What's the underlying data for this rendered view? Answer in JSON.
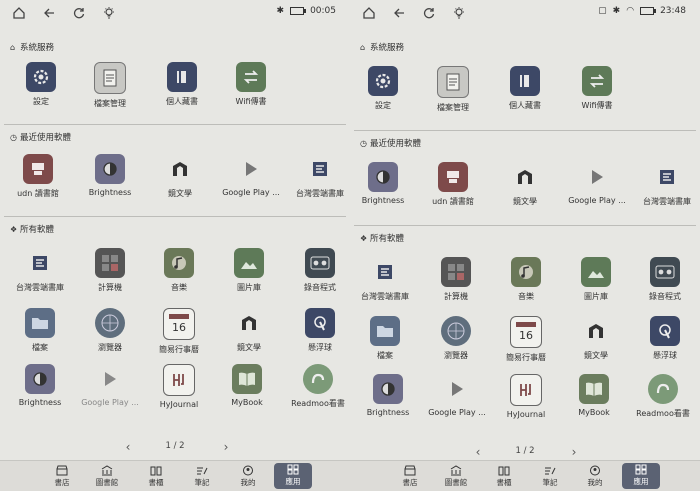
{
  "left": {
    "status_time": "00:05",
    "sections": {
      "system": "系統服務",
      "recent": "最近使用軟體",
      "all": "所有軟體"
    },
    "system_apps": [
      {
        "label": "設定",
        "icon": "settings-icon"
      },
      {
        "label": "檔案管理",
        "icon": "file-manager-icon"
      },
      {
        "label": "個人藏書",
        "icon": "personal-library-icon"
      },
      {
        "label": "Wifi傳書",
        "icon": "wifi-transfer-icon"
      }
    ],
    "recent_apps": [
      {
        "label": "udn 讀書館",
        "icon": "udn-library-icon"
      },
      {
        "label": "Brightness",
        "icon": "brightness-icon"
      },
      {
        "label": "鏡文學",
        "icon": "mirror-fiction-icon"
      },
      {
        "label": "Google Play ...",
        "icon": "google-play-icon"
      },
      {
        "label": "台灣雲端書庫",
        "icon": "taiwan-cloud-library-icon"
      }
    ],
    "all_apps": [
      {
        "label": "台灣雲端書庫",
        "icon": "taiwan-cloud-library-icon"
      },
      {
        "label": "計算機",
        "icon": "calculator-icon"
      },
      {
        "label": "音樂",
        "icon": "music-icon"
      },
      {
        "label": "圖片庫",
        "icon": "gallery-icon"
      },
      {
        "label": "錄音程式",
        "icon": "recorder-icon"
      },
      {
        "label": "檔案",
        "icon": "files-icon"
      },
      {
        "label": "瀏覽器",
        "icon": "browser-icon"
      },
      {
        "label": "簡易行事曆",
        "icon": "calendar-icon"
      },
      {
        "label": "鏡文學",
        "icon": "mirror-fiction-icon"
      },
      {
        "label": "懸浮球",
        "icon": "floating-ball-icon"
      },
      {
        "label": "Brightness",
        "icon": "brightness-icon"
      },
      {
        "label": "Google Play ...",
        "icon": "google-play-icon"
      },
      {
        "label": "HyJournal",
        "icon": "hyjournal-icon"
      },
      {
        "label": "MyBook",
        "icon": "mybook-icon"
      },
      {
        "label": "Readmoo看書",
        "icon": "readmoo-icon"
      }
    ],
    "calendar_day": "16",
    "pager": "1 / 2",
    "nav": [
      "書店",
      "圖書館",
      "書櫃",
      "筆記",
      "我的",
      "應用"
    ]
  },
  "right": {
    "status_time": "23:48",
    "sections": {
      "system": "系統服務",
      "recent": "最近使用軟體",
      "all": "所有軟體"
    },
    "system_apps": [
      {
        "label": "設定",
        "icon": "settings-icon"
      },
      {
        "label": "檔案管理",
        "icon": "file-manager-icon"
      },
      {
        "label": "個人藏書",
        "icon": "personal-library-icon"
      },
      {
        "label": "Wifi傳書",
        "icon": "wifi-transfer-icon"
      }
    ],
    "recent_apps": [
      {
        "label": "Brightness",
        "icon": "brightness-icon"
      },
      {
        "label": "udn 讀書館",
        "icon": "udn-library-icon"
      },
      {
        "label": "鏡文學",
        "icon": "mirror-fiction-icon"
      },
      {
        "label": "Google Play ...",
        "icon": "google-play-icon"
      },
      {
        "label": "台灣雲端書庫",
        "icon": "taiwan-cloud-library-icon"
      }
    ],
    "all_apps": [
      {
        "label": "台灣雲端書庫",
        "icon": "taiwan-cloud-library-icon"
      },
      {
        "label": "計算機",
        "icon": "calculator-icon"
      },
      {
        "label": "音樂",
        "icon": "music-icon"
      },
      {
        "label": "圖片庫",
        "icon": "gallery-icon"
      },
      {
        "label": "錄音程式",
        "icon": "recorder-icon"
      },
      {
        "label": "檔案",
        "icon": "files-icon"
      },
      {
        "label": "瀏覽器",
        "icon": "browser-icon"
      },
      {
        "label": "簡易行事曆",
        "icon": "calendar-icon"
      },
      {
        "label": "鏡文學",
        "icon": "mirror-fiction-icon"
      },
      {
        "label": "懸浮球",
        "icon": "floating-ball-icon"
      },
      {
        "label": "Brightness",
        "icon": "brightness-icon"
      },
      {
        "label": "Google Play ...",
        "icon": "google-play-icon"
      },
      {
        "label": "HyJournal",
        "icon": "hyjournal-icon"
      },
      {
        "label": "MyBook",
        "icon": "mybook-icon"
      },
      {
        "label": "Readmoo看書",
        "icon": "readmoo-icon"
      }
    ],
    "calendar_day": "16",
    "pager": "1 / 2",
    "nav": [
      "書店",
      "圖書館",
      "書櫃",
      "筆記",
      "我的",
      "應用"
    ]
  },
  "colors": {
    "navy": "#3d4866",
    "gray_icon": "#8f8f93",
    "accent_green": "#5e7a58",
    "active_nav": "#5b6273"
  }
}
